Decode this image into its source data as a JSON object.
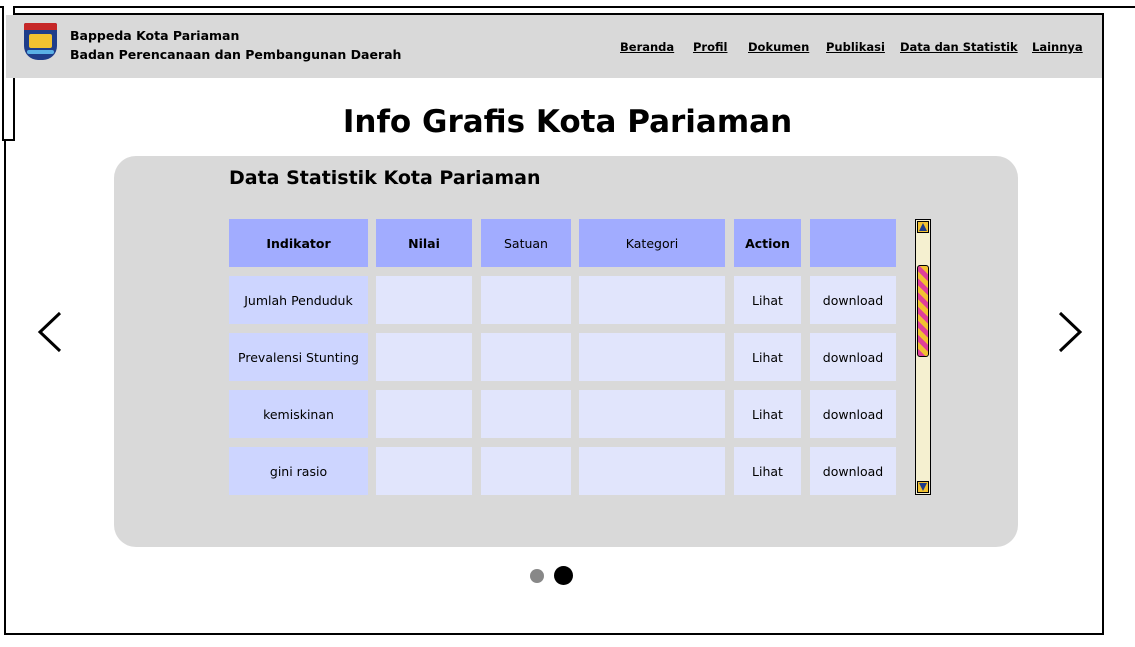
{
  "header": {
    "org_name": "Bappeda Kota Pariaman",
    "org_subtitle": "Badan Perencanaan dan Pembangunan Daerah",
    "nav": [
      {
        "label": "Beranda"
      },
      {
        "label": "Profil"
      },
      {
        "label": "Dokumen"
      },
      {
        "label": "Publikasi"
      },
      {
        "label": "Data dan Statistik"
      },
      {
        "label": "Lainnya"
      }
    ]
  },
  "page": {
    "title": "Info Grafis Kota Pariaman"
  },
  "panel": {
    "title": "Data Statistik Kota Pariaman",
    "table": {
      "columns": [
        "Indikator",
        "Nilai",
        "Satuan",
        "Kategori",
        "Action",
        ""
      ],
      "rows": [
        {
          "indikator": "Jumlah Penduduk",
          "nilai": "",
          "satuan": "",
          "kategori": "",
          "action": "Lihat",
          "download": "download"
        },
        {
          "indikator": "Prevalensi Stunting",
          "nilai": "",
          "satuan": "",
          "kategori": "",
          "action": "Lihat",
          "download": "download"
        },
        {
          "indikator": "kemiskinan",
          "nilai": "",
          "satuan": "",
          "kategori": "",
          "action": "Lihat",
          "download": "download"
        },
        {
          "indikator": "gini rasio",
          "nilai": "",
          "satuan": "",
          "kategori": "",
          "action": "Lihat",
          "download": "download"
        }
      ]
    }
  },
  "carousel": {
    "prev_icon": "chevron-left-icon",
    "next_icon": "chevron-right-icon",
    "dots": [
      {
        "active": false,
        "color": "#888888"
      },
      {
        "active": true,
        "color": "#000000"
      }
    ]
  },
  "colors": {
    "header_bg": "#d9d9d9",
    "panel_bg": "#d9d9d9",
    "table_header": "#a1acff",
    "indicator_cell": "#cdd5ff",
    "value_cell": "#e1e5fc",
    "scroll_thumb_a": "#e0409a",
    "scroll_thumb_b": "#f2c230"
  }
}
